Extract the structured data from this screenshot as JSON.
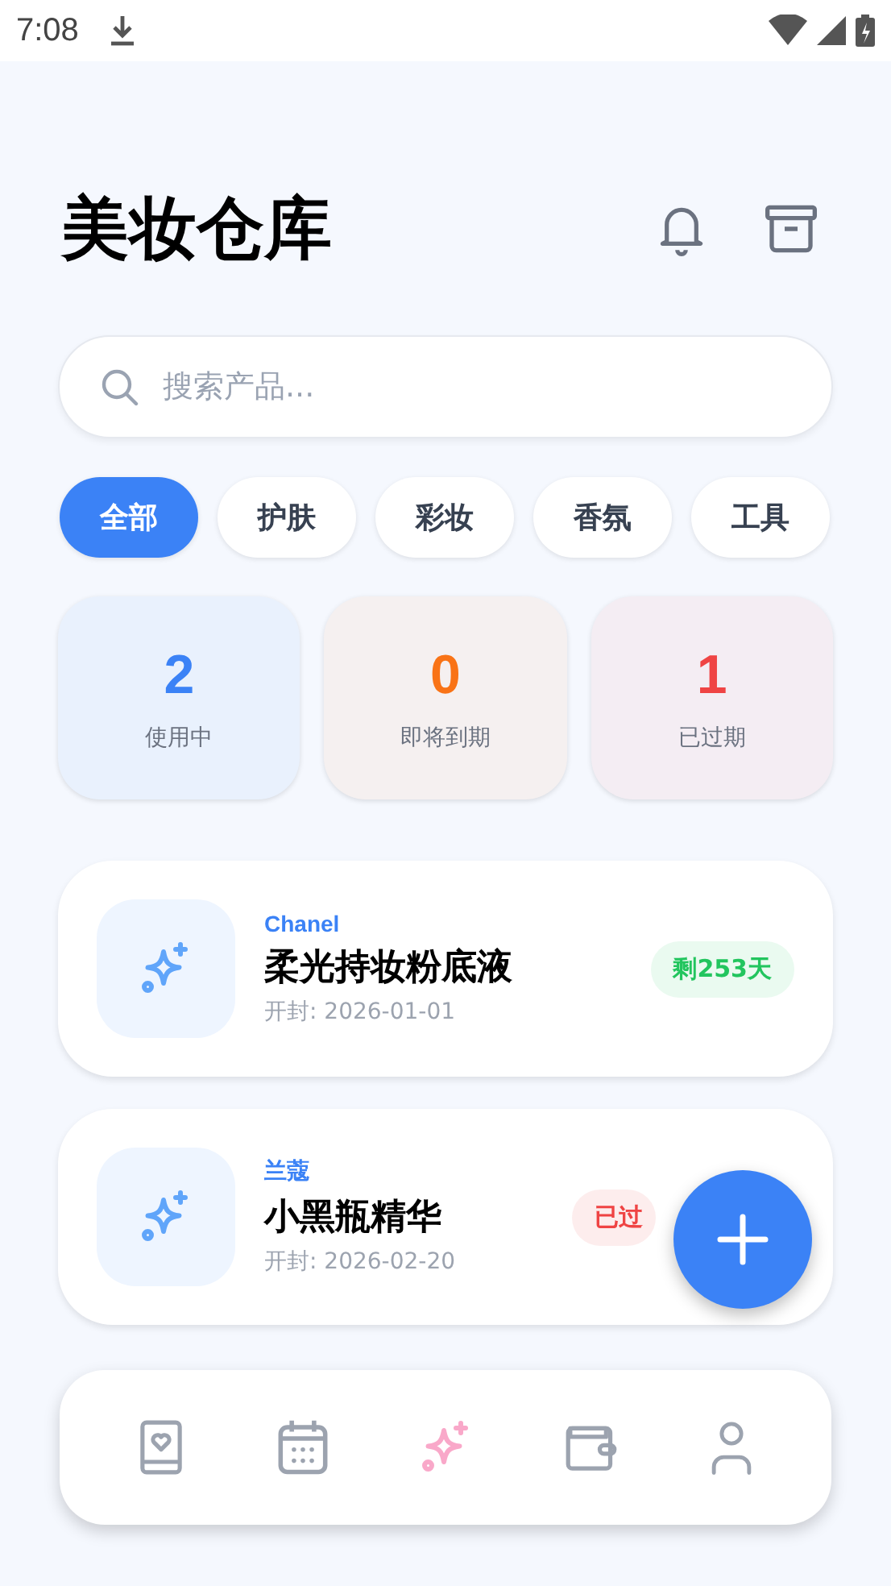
{
  "status_bar": {
    "time": "7:08"
  },
  "header": {
    "title": "美妆仓库"
  },
  "search": {
    "placeholder": "搜索产品..."
  },
  "categories": [
    {
      "label": "全部",
      "selected": true
    },
    {
      "label": "护肤",
      "selected": false
    },
    {
      "label": "彩妆",
      "selected": false
    },
    {
      "label": "香氛",
      "selected": false
    },
    {
      "label": "工具",
      "selected": false
    }
  ],
  "stats": [
    {
      "value": "2",
      "label": "使用中",
      "color": "#3b82f6"
    },
    {
      "value": "0",
      "label": "即将到期",
      "color": "#f97316"
    },
    {
      "value": "1",
      "label": "已过期",
      "color": "#ef4444"
    }
  ],
  "products": [
    {
      "brand": "Chanel",
      "name": "柔光持妆粉底液",
      "opened": "开封: 2026-01-01",
      "badge": "剩253天",
      "color": "#22c55e"
    },
    {
      "brand": "兰蔻",
      "name": "小黑瓶精华",
      "opened": "开封: 2026-02-20",
      "badge": "已过",
      "color": "#ef4444"
    }
  ],
  "nav": [
    {
      "kind": "book",
      "selected": false
    },
    {
      "kind": "calendar",
      "selected": false
    },
    {
      "kind": "sparkle",
      "selected": true
    },
    {
      "kind": "wallet",
      "selected": false
    },
    {
      "kind": "user",
      "selected": false
    }
  ]
}
